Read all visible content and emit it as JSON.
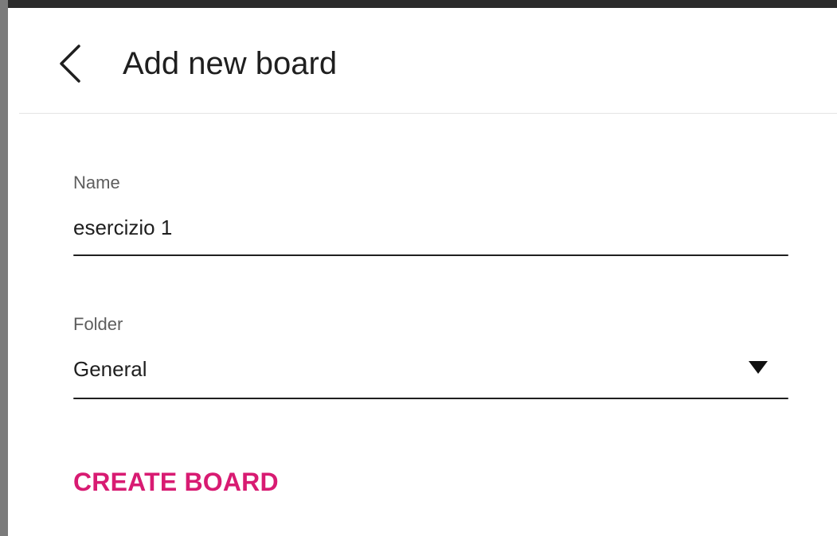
{
  "header": {
    "title": "Add new board",
    "back_icon": "chevron-left-icon"
  },
  "form": {
    "name": {
      "label": "Name",
      "value": "esercizio 1"
    },
    "folder": {
      "label": "Folder",
      "selected": "General",
      "dropdown_icon": "triangle-down-icon"
    }
  },
  "actions": {
    "create_label": "CREATE BOARD"
  },
  "colors": {
    "accent": "#d81b72",
    "text": "#1f1f1f",
    "label": "#5d5d5d",
    "divider": "#e4e4e4"
  }
}
